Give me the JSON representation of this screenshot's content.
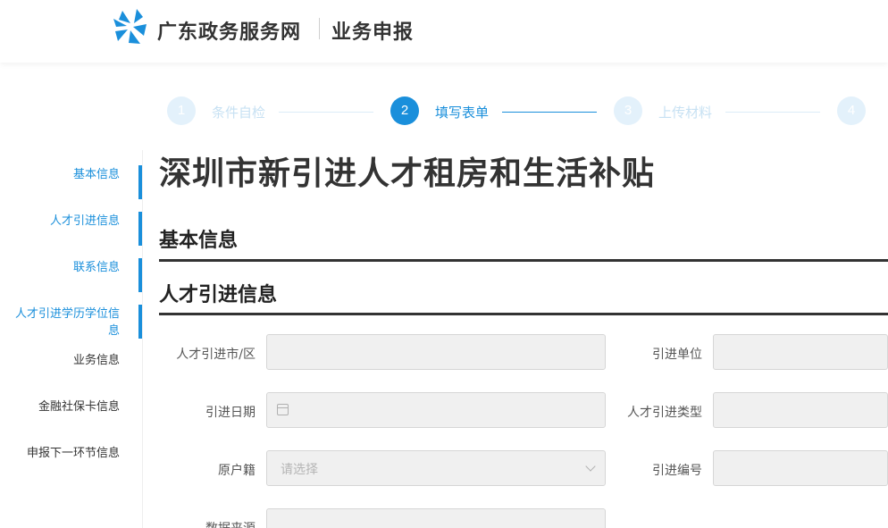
{
  "header": {
    "brand": "广东政务服务网",
    "sub_brand": "业务申报"
  },
  "steps": [
    {
      "number": "1",
      "label": "条件自检",
      "state": "inactive"
    },
    {
      "number": "2",
      "label": "填写表单",
      "state": "active"
    },
    {
      "number": "3",
      "label": "上传材料",
      "state": "inactive"
    },
    {
      "number": "4",
      "label": "",
      "state": "inactive"
    }
  ],
  "sidebar": {
    "items": [
      {
        "label": "基本信息",
        "state": "done"
      },
      {
        "label": "人才引进信息",
        "state": "done"
      },
      {
        "label": "联系信息",
        "state": "done"
      },
      {
        "label": "人才引进学历学位信息",
        "state": "done"
      },
      {
        "label": "业务信息",
        "state": "todo"
      },
      {
        "label": "金融社保卡信息",
        "state": "todo"
      },
      {
        "label": "申报下一环节信息",
        "state": "todo"
      }
    ]
  },
  "main": {
    "title": "深圳市新引进人才租房和生活补贴",
    "sections": {
      "basic": "基本信息",
      "talent": "人才引进信息"
    },
    "fields": {
      "city": {
        "label": "人才引进市/区",
        "value": ""
      },
      "unit": {
        "label": "引进单位",
        "value": ""
      },
      "date": {
        "label": "引进日期",
        "value": ""
      },
      "type": {
        "label": "人才引进类型",
        "value": ""
      },
      "household": {
        "label": "原户籍",
        "placeholder": "请选择"
      },
      "number": {
        "label": "引进编号",
        "value": ""
      },
      "source": {
        "label": "数据来源",
        "value": ""
      }
    }
  },
  "colors": {
    "accent": "#1a8fdb",
    "accent_light": "#e3f1fb",
    "text": "#333333",
    "field_bg": "#f0f0f0"
  },
  "icons": {
    "logo": "guangdong-gov-logo-icon",
    "date": "calendar-icon",
    "select": "chevron-down-icon"
  }
}
